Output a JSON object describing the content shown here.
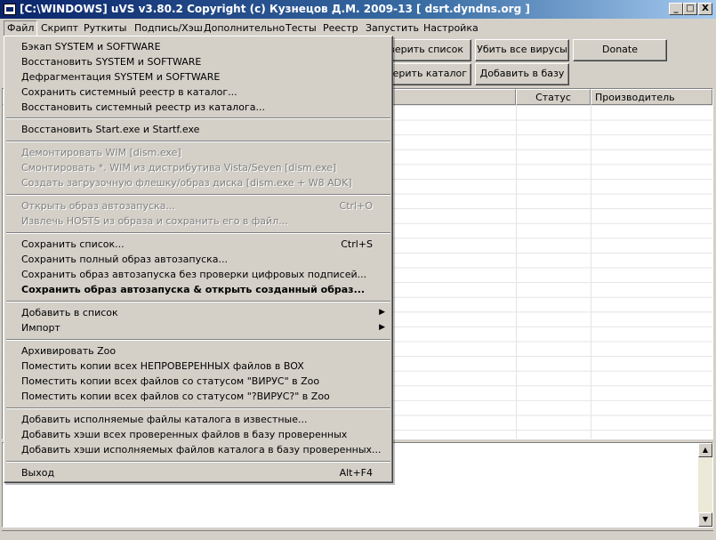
{
  "window": {
    "title": "[C:\\WINDOWS] uVS v3.80.2 Copyright (c) Кузнецов Д.М. 2009-13 [ dsrt.dyndns.org ]",
    "minimize": "_",
    "maximize": "□",
    "close": "X"
  },
  "menubar": {
    "items": [
      "Файл",
      "Скрипт",
      "Руткиты",
      "Подпись/Хэш",
      "Дополнительно",
      "Тесты",
      "Реестр",
      "Запустить",
      "Настройка"
    ]
  },
  "toolbar": {
    "check_list": "оверить список",
    "kill_viruses": "Убить все вирусы",
    "donate": "Donate",
    "check_catalog": "оверить каталог",
    "add_to_db": "Добавить в базу"
  },
  "grid": {
    "columns": [
      "",
      "Статус",
      "Производитель"
    ]
  },
  "file_menu": {
    "items": [
      {
        "label": "Бэкап SYSTEM и SOFTWARE",
        "accel": "",
        "disabled": false
      },
      {
        "label": "Восстановить SYSTEM и SOFTWARE",
        "accel": "",
        "disabled": false
      },
      {
        "label": "Дефрагментация SYSTEM и SOFTWARE",
        "accel": "",
        "disabled": false
      },
      {
        "label": "Сохранить системный реестр в каталог...",
        "accel": "",
        "disabled": false
      },
      {
        "label": "Восстановить системный реестр из каталога...",
        "accel": "",
        "disabled": false
      },
      {
        "label": "Восстановить Start.exe и Startf.exe",
        "accel": "",
        "disabled": false
      },
      {
        "label": "Демонтировать  WIM [dism.exe]",
        "accel": "",
        "disabled": true
      },
      {
        "label": "Смонтировать *. WIM из дистрибутива Vista/Seven [dism.exe]",
        "accel": "",
        "disabled": true
      },
      {
        "label": "Создать загрузочную флешку/образ диска [dism.exe + W8 ADK]",
        "accel": "",
        "disabled": true
      },
      {
        "label": "Открыть образ автозапуска...",
        "accel": "Ctrl+O",
        "disabled": true
      },
      {
        "label": "Извлечь HOSTS из образа и сохранить его в файл...",
        "accel": "",
        "disabled": true
      },
      {
        "label": "Сохранить список...",
        "accel": "Ctrl+S",
        "disabled": false
      },
      {
        "label": "Сохранить полный образ автозапуска...",
        "accel": "",
        "disabled": false
      },
      {
        "label": "Сохранить образ автозапуска без проверки цифровых подписей...",
        "accel": "",
        "disabled": false
      },
      {
        "label": "Сохранить образ автозапуска & открыть созданный образ...",
        "accel": "",
        "disabled": false,
        "bold": true
      },
      {
        "label": "Добавить в список",
        "accel": "",
        "disabled": false,
        "submenu": true
      },
      {
        "label": "Импорт",
        "accel": "",
        "disabled": false,
        "submenu": true
      },
      {
        "label": "Архивировать Zoo",
        "accel": "",
        "disabled": false
      },
      {
        "label": "Поместить копии всех НЕПРОВЕРЕННЫХ файлов в BOX",
        "accel": "",
        "disabled": false
      },
      {
        "label": "Поместить копии всех файлов со статусом \"ВИРУС\" в Zoo",
        "accel": "",
        "disabled": false
      },
      {
        "label": "Поместить копии всех файлов со статусом \"?ВИРУС?\" в Zoo",
        "accel": "",
        "disabled": false
      },
      {
        "label": "Добавить исполняемые файлы каталога в известные...",
        "accel": "",
        "disabled": false
      },
      {
        "label": "Добавить хэши всех проверенных файлов в базу проверенных",
        "accel": "",
        "disabled": false
      },
      {
        "label": "Добавить хэши исполняемых файлов каталога в базу проверенных...",
        "accel": "",
        "disabled": false
      },
      {
        "label": "Выход",
        "accel": "Alt+F4",
        "disabled": false
      }
    ]
  }
}
